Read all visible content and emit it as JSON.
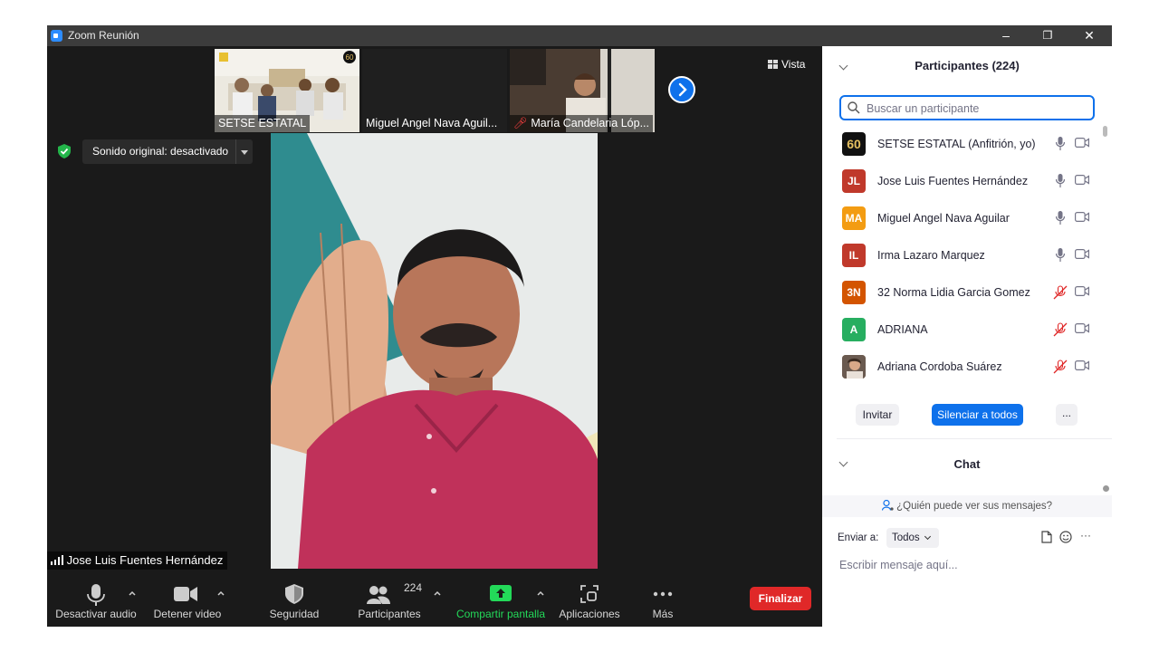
{
  "window": {
    "title": "Zoom Reunión",
    "minimize": "–",
    "restore": "❐",
    "close": "✕"
  },
  "thumbnails": [
    {
      "name": "SETSE ESTATAL"
    },
    {
      "name": "Miguel Angel Nava Aguil..."
    },
    {
      "name": "María Candelaria Lóp..."
    }
  ],
  "view_button": "Vista",
  "original_sound": "Sonido original: desactivado",
  "active_speaker": "Jose Luis Fuentes Hernández",
  "toolbar": {
    "audio": "Desactivar audio",
    "video": "Detener video",
    "security": "Seguridad",
    "participants": "Participantes",
    "participants_count": "224",
    "share": "Compartir pantalla",
    "apps": "Aplicaciones",
    "more": "Más",
    "end": "Finalizar"
  },
  "participants_panel": {
    "title": "Participantes (224)",
    "search_placeholder": "Buscar un participante",
    "list": [
      {
        "name": "SETSE ESTATAL (Anfitrión, yo)",
        "avatar_text": "60",
        "color": "#111111",
        "muted": false
      },
      {
        "name": "Jose Luis Fuentes Hernández",
        "avatar_text": "JL",
        "color": "#c0392b",
        "muted": false
      },
      {
        "name": "Miguel Angel Nava Aguilar",
        "avatar_text": "MA",
        "color": "#f39c12",
        "muted": false
      },
      {
        "name": "Irma Lazaro Marquez",
        "avatar_text": "IL",
        "color": "#c0392b",
        "muted": false
      },
      {
        "name": "32 Norma Lidia Garcia Gomez",
        "avatar_text": "3N",
        "color": "#d35400",
        "muted": true
      },
      {
        "name": "ADRIANA",
        "avatar_text": "A",
        "color": "#27ae60",
        "muted": true
      },
      {
        "name": "Adriana Cordoba Suárez",
        "avatar_text": "",
        "color": "#8a6a4a",
        "muted": true
      }
    ],
    "invite": "Invitar",
    "mute_all": "Silenciar a todos",
    "more": "..."
  },
  "chat": {
    "title": "Chat",
    "who_can_see": "¿Quién puede ver sus mensajes?",
    "send_to_label": "Enviar a:",
    "send_to_value": "Todos",
    "more": "···",
    "message_placeholder": "Escribir mensaje aquí..."
  },
  "colors": {
    "accent": "#0e71eb",
    "end": "#e02828",
    "share": "#23d959",
    "muted_icon": "#e02828"
  }
}
